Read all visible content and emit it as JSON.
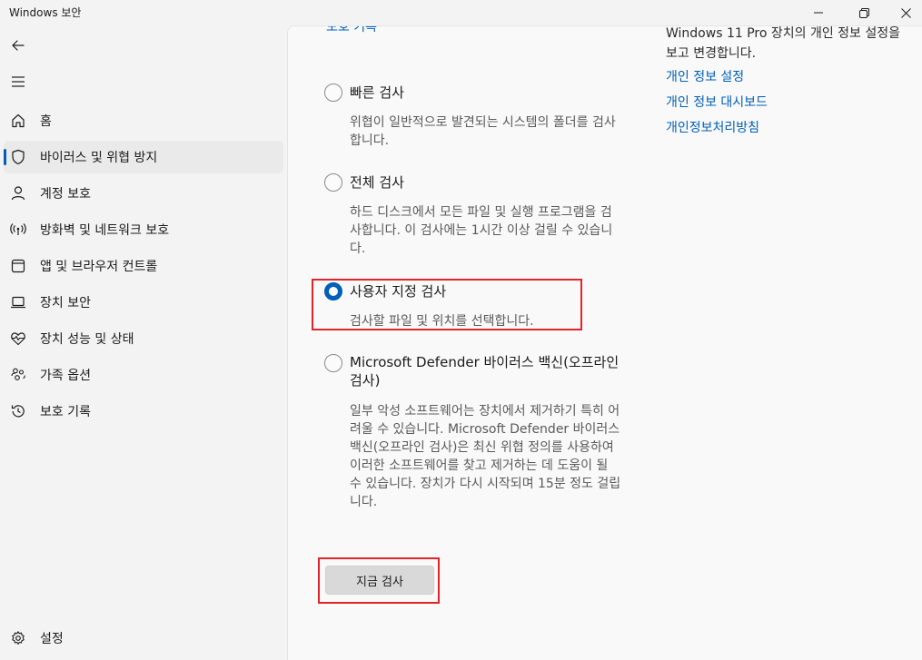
{
  "window": {
    "title": "Windows 보안"
  },
  "sidebar": {
    "items": [
      {
        "label": "홈",
        "icon": "home-icon"
      },
      {
        "label": "바이러스 및 위협 방지",
        "icon": "shield-icon",
        "active": true
      },
      {
        "label": "계정 보호",
        "icon": "person-icon"
      },
      {
        "label": "방화벽 및 네트워크 보호",
        "icon": "wifi-antenna-icon"
      },
      {
        "label": "앱 및 브라우저 컨트롤",
        "icon": "app-window-icon"
      },
      {
        "label": "장치 보안",
        "icon": "laptop-icon"
      },
      {
        "label": "장치 성능 및 상태",
        "icon": "heart-pulse-icon"
      },
      {
        "label": "가족 옵션",
        "icon": "family-icon"
      },
      {
        "label": "보호 기록",
        "icon": "history-icon"
      }
    ],
    "settings_label": "설정"
  },
  "main": {
    "clipped_heading": "보호 기록",
    "options": [
      {
        "title": "빠른 검사",
        "description": "위협이 일반적으로 발견되는 시스템의 폴더를 검사합니다.",
        "selected": false
      },
      {
        "title": "전체 검사",
        "description": "하드 디스크에서 모든 파일 및 실행 프로그램을 검사합니다. 이 검사에는 1시간 이상 걸릴 수 있습니다.",
        "selected": false
      },
      {
        "title": "사용자 지정 검사",
        "description": "검사할 파일 및 위치를 선택합니다.",
        "selected": true
      },
      {
        "title": "Microsoft Defender 바이러스 백신(오프라인 검사)",
        "description": "일부 악성 소프트웨어는 장치에서 제거하기 특히 어려울 수 있습니다. Microsoft Defender 바이러스 백신(오프라인 검사)은 최신 위협 정의를 사용하여 이러한 소프트웨어를 찾고 제거하는 데 도움이 될 수 있습니다. 장치가 다시 시작되며 15분 정도 걸립니다.",
        "selected": false
      }
    ],
    "scan_now_label": "지금 검사"
  },
  "info_panel": {
    "text": "Windows 11 Pro 장치의 개인 정보 설정을 보고 변경합니다.",
    "links": [
      "개인 정보 설정",
      "개인 정보 대시보드",
      "개인정보처리방침"
    ]
  },
  "colors": {
    "accent": "#005fb8",
    "highlight": "#e0242a"
  }
}
